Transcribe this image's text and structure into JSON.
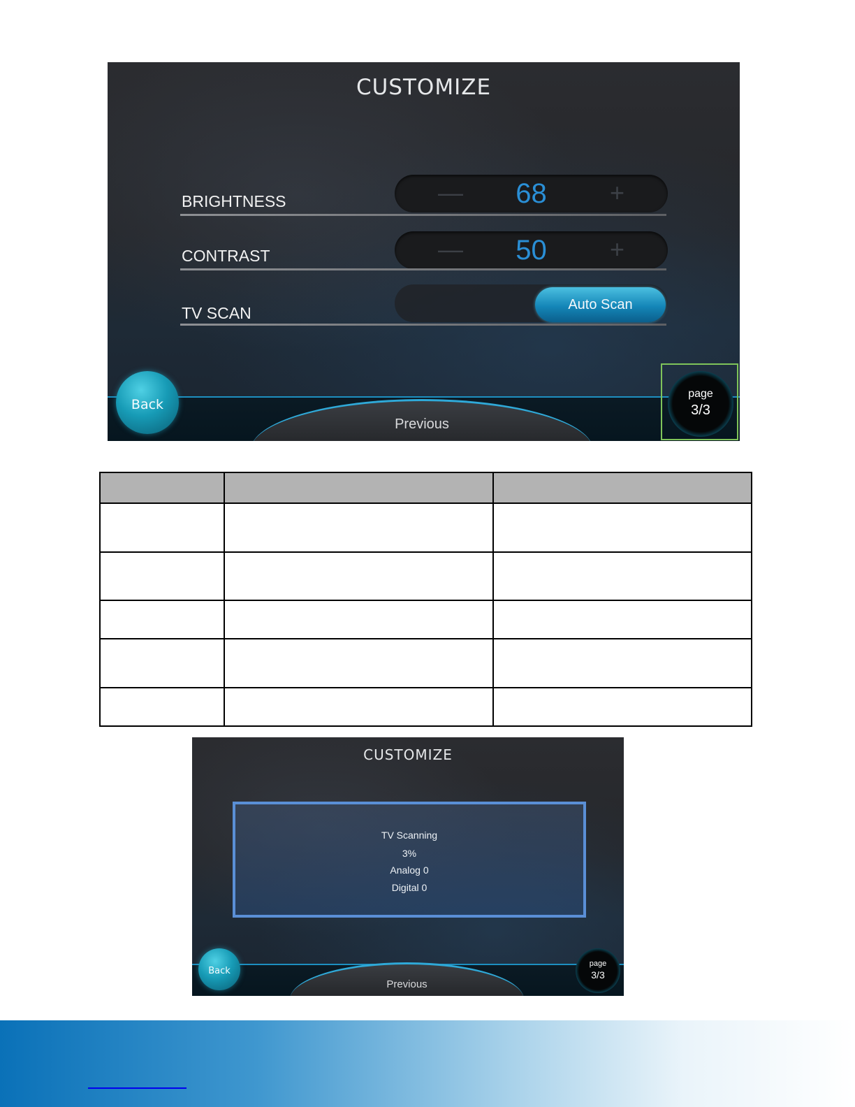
{
  "screen1": {
    "title": "CUSTOMIZE",
    "rows": [
      {
        "label": "BRIGHTNESS",
        "value": "68",
        "minus": "—",
        "plus": "+"
      },
      {
        "label": "CONTRAST",
        "value": "50",
        "minus": "—",
        "plus": "+"
      },
      {
        "label": "TV SCAN",
        "button": "Auto Scan"
      }
    ],
    "back": "Back",
    "previous": "Previous",
    "page_word": "page",
    "page_number": "3/3"
  },
  "screen2": {
    "title": "CUSTOMIZE",
    "dialog": {
      "line1": "TV Scanning",
      "line2": "3%",
      "line3": "Analog 0",
      "line4": "Digital 0"
    },
    "back": "Back",
    "previous": "Previous",
    "page_word": "page",
    "page_number": "3/3"
  },
  "colors": {
    "accent": "#2a8fd6",
    "button": "#1486b8",
    "highlight": "#7fc45a",
    "table_header": "#b3b3b3"
  }
}
